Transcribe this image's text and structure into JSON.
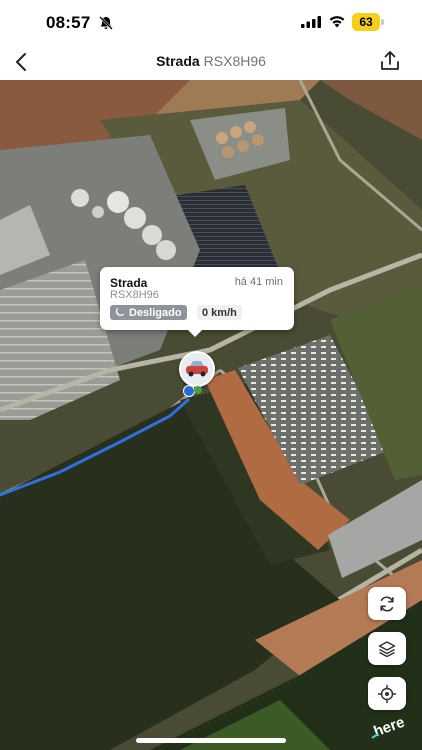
{
  "status_bar": {
    "time": "08:57",
    "battery": "63",
    "icons": [
      "bell-slash-icon",
      "signal-icon",
      "wifi-icon",
      "battery-icon"
    ],
    "battery_color": "#f5cf1a"
  },
  "header": {
    "vehicle_name": "Strada",
    "plate": "RSX8H96",
    "back_icon": "chevron-left-icon",
    "share_icon": "share-icon"
  },
  "map": {
    "provider_logo": "here",
    "route_color": "#2f6fe0"
  },
  "popup": {
    "name": "Strada",
    "time_ago": "há 41 min",
    "plate": "RSX8H96",
    "status": "Desligado",
    "status_icon": "moon-icon",
    "speed": "0 km/h",
    "status_color": "#8e9499"
  },
  "controls": {
    "refresh_icon": "refresh-icon",
    "layers_icon": "layers-icon",
    "locate_icon": "locate-icon"
  }
}
